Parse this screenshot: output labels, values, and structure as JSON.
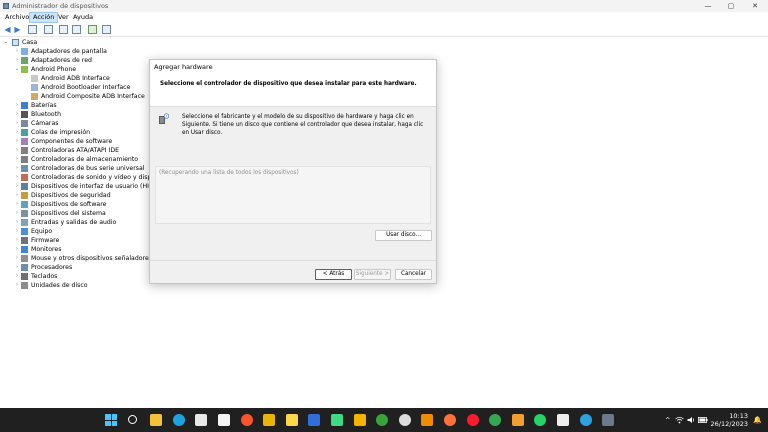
{
  "window": {
    "title": "Administrador de dispositivos",
    "controls": {
      "minimize": "—",
      "maximize": "▢",
      "close": "✕"
    }
  },
  "menu": [
    "Archivo",
    "Acción",
    "Ver",
    "Ayuda"
  ],
  "menu_active_index": 1,
  "toolbar_icons": [
    "back-arrow-icon",
    "forward-arrow-icon",
    "properties-icon",
    "list-view-icon",
    "help-icon",
    "details-icon",
    "scan-hardware-icon",
    "monitor-icon"
  ],
  "tree": {
    "root": "Casa",
    "items": [
      {
        "label": "Adaptadores de pantalla",
        "level": 1,
        "expanded": false,
        "icon": "display-adapter-icon"
      },
      {
        "label": "Adaptadores de red",
        "level": 1,
        "expanded": false,
        "icon": "network-adapter-icon"
      },
      {
        "label": "Android Phone",
        "level": 1,
        "expanded": true,
        "icon": "android-phone-icon"
      },
      {
        "label": "Android ADB Interface",
        "level": 2,
        "expanded": null,
        "icon": "adb-device-icon"
      },
      {
        "label": "Android Bootloader Interface",
        "level": 2,
        "expanded": null,
        "icon": "adb-device-icon"
      },
      {
        "label": "Android Composite ADB Interface",
        "level": 2,
        "expanded": null,
        "icon": "adb-device-icon"
      },
      {
        "label": "Baterías",
        "level": 1,
        "expanded": false,
        "icon": "battery-icon"
      },
      {
        "label": "Bluetooth",
        "level": 1,
        "expanded": false,
        "icon": "bluetooth-icon"
      },
      {
        "label": "Cámaras",
        "level": 1,
        "expanded": false,
        "icon": "camera-icon"
      },
      {
        "label": "Colas de impresión",
        "level": 1,
        "expanded": false,
        "icon": "printer-icon"
      },
      {
        "label": "Componentes de software",
        "level": 1,
        "expanded": false,
        "icon": "software-component-icon"
      },
      {
        "label": "Controladoras ATA/ATAPI IDE",
        "level": 1,
        "expanded": false,
        "icon": "ide-controller-icon"
      },
      {
        "label": "Controladoras de almacenamiento",
        "level": 1,
        "expanded": false,
        "icon": "storage-controller-icon"
      },
      {
        "label": "Controladoras de bus serie universal",
        "level": 1,
        "expanded": false,
        "icon": "usb-icon"
      },
      {
        "label": "Controladoras de sonido y vídeo y dispositivos de juego",
        "level": 1,
        "expanded": false,
        "icon": "sound-icon"
      },
      {
        "label": "Dispositivos de interfaz de usuario (HID)",
        "level": 1,
        "expanded": false,
        "icon": "hid-icon"
      },
      {
        "label": "Dispositivos de seguridad",
        "level": 1,
        "expanded": false,
        "icon": "security-device-icon"
      },
      {
        "label": "Dispositivos de software",
        "level": 1,
        "expanded": false,
        "icon": "software-device-icon"
      },
      {
        "label": "Dispositivos del sistema",
        "level": 1,
        "expanded": false,
        "icon": "system-device-icon"
      },
      {
        "label": "Entradas y salidas de audio",
        "level": 1,
        "expanded": false,
        "icon": "audio-io-icon"
      },
      {
        "label": "Equipo",
        "level": 1,
        "expanded": false,
        "icon": "computer-icon"
      },
      {
        "label": "Firmware",
        "level": 1,
        "expanded": false,
        "icon": "firmware-icon"
      },
      {
        "label": "Monitores",
        "level": 1,
        "expanded": false,
        "icon": "monitor-icon"
      },
      {
        "label": "Mouse y otros dispositivos señaladores",
        "level": 1,
        "expanded": false,
        "icon": "mouse-icon"
      },
      {
        "label": "Procesadores",
        "level": 1,
        "expanded": false,
        "icon": "processor-icon"
      },
      {
        "label": "Teclados",
        "level": 1,
        "expanded": false,
        "icon": "keyboard-icon"
      },
      {
        "label": "Unidades de disco",
        "level": 1,
        "expanded": false,
        "icon": "disk-drive-icon"
      }
    ]
  },
  "dialog": {
    "title": "Agregar hardware",
    "heading": "Seleccione el controlador de dispositivo que desea instalar para este hardware.",
    "instructions": "Seleccione el fabricante y el modelo de su dispositivo de hardware y haga clic en Siguiente. Si tiene un disco que contiene el controlador que desea instalar, haga clic en Usar disco.",
    "list_placeholder": "(Recuperando una lista de todos los dispositivos)",
    "use_disk_label": "Usar disco...",
    "back_label": "< Atrás",
    "next_label": "Siguiente >",
    "cancel_label": "Cancelar"
  },
  "taskbar": {
    "apps": [
      "windows-start-icon",
      "search-icon",
      "file-explorer-icon",
      "edge-icon",
      "store-icon",
      "l-app-icon",
      "brave-icon",
      "magnifier-app-icon",
      "notes-icon",
      "ps-icon",
      "android-studio-icon",
      "winamp-icon",
      "xbox-icon",
      "clock-app-icon",
      "vlc-icon",
      "firefox-icon",
      "opera-icon",
      "chrome-icon",
      "layers-icon",
      "whatsapp-icon",
      "capcut-icon",
      "telegram-icon",
      "device-manager-icon"
    ],
    "tray": {
      "chevron": "^",
      "wifi": "wifi-icon",
      "volume": "volume-icon",
      "battery": "battery-icon"
    },
    "time": "10:13",
    "date": "26/12/2023"
  },
  "colors": {
    "accent": "#0078d4",
    "menu_active_bg": "#cce4f7",
    "taskbar_bg": "#202020",
    "dialog_bg": "#f0f0f0"
  }
}
